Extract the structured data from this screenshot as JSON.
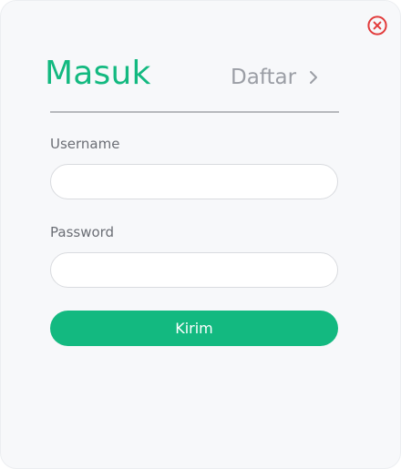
{
  "dialog": {
    "close_icon": "close-circle-icon",
    "accent_color": "#13b980",
    "close_color": "#e23b3b"
  },
  "tabs": {
    "login_label": "Masuk",
    "register_label": "Daftar",
    "register_icon": "chevron-right-icon"
  },
  "form": {
    "username_label": "Username",
    "username_value": "",
    "password_label": "Password",
    "password_value": "",
    "submit_label": "Kirim"
  }
}
